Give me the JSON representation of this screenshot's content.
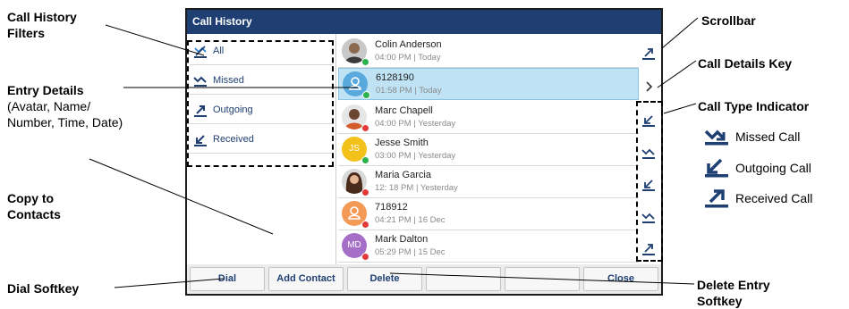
{
  "annotations": {
    "call_history_filters": "Call History\nFilters",
    "entry_details_title": "Entry Details",
    "entry_details_sub": "(Avatar, Name/\nNumber, Time, Date)",
    "copy_to_contacts": "Copy to\nContacts",
    "dial_softkey": "Dial Softkey",
    "scrollbar": "Scrollbar",
    "call_details_key": "Call Details Key",
    "call_type_indicator": "Call Type Indicator",
    "delete_entry_softkey": "Delete Entry\nSoftkey",
    "legend": [
      {
        "label": "Missed Call",
        "icon": "missed-call-icon"
      },
      {
        "label": "Outgoing Call",
        "icon": "outgoing-call-icon"
      },
      {
        "label": "Received Call",
        "icon": "received-call-icon"
      }
    ]
  },
  "screen": {
    "title": "Call History",
    "filters": [
      {
        "label": "All",
        "icon": "all-calls-icon",
        "selected": true
      },
      {
        "label": "Missed",
        "icon": "missed-call-icon"
      },
      {
        "label": "Outgoing",
        "icon": "outgoing-call-icon"
      },
      {
        "label": "Received",
        "icon": "received-call-icon"
      }
    ],
    "entries": [
      {
        "name": "Colin Anderson",
        "time": "04:00 PM | Today",
        "avatar": "photo",
        "status": "#2bb24c",
        "type": "outgoing"
      },
      {
        "name": "6128190",
        "time": "01:58 PM | Today",
        "avatar": "contact-icon",
        "avatar_color": "#5aa9dd",
        "status": "#2bb24c",
        "selected": true,
        "type": "details"
      },
      {
        "name": "Marc Chapell",
        "time": "04:00 PM | Yesterday",
        "avatar": "photo",
        "status": "#e2393a",
        "type": "received"
      },
      {
        "name": "Jesse Smith",
        "time": "03:00 PM | Yesterday",
        "avatar": "initials",
        "initials": "JS",
        "avatar_color": "#f2c21b",
        "status": "#2bb24c",
        "type": "missed"
      },
      {
        "name": "Maria Garcia",
        "time": "12: 18 PM | Yesterday",
        "avatar": "photo",
        "status": "#e2393a",
        "type": "received"
      },
      {
        "name": "718912",
        "time": "04:21 PM | 16 Dec",
        "avatar": "contact-icon",
        "avatar_color": "#f39a57",
        "status": "#e2393a",
        "type": "missed"
      },
      {
        "name": "Mark Dalton",
        "time": "05:29 PM | 15 Dec",
        "avatar": "initials",
        "initials": "MD",
        "avatar_color": "#a56ec7",
        "status": "#e2393a",
        "type": "outgoing"
      }
    ],
    "details_key_icon": "chevron-right-icon",
    "softkeys": [
      "Dial",
      "Add Contact",
      "Delete",
      "",
      "",
      "Close"
    ]
  },
  "colors": {
    "titlebar": "#1f3f73",
    "selected_row": "#bfe3f5",
    "icon_blue": "#1f3f73"
  }
}
